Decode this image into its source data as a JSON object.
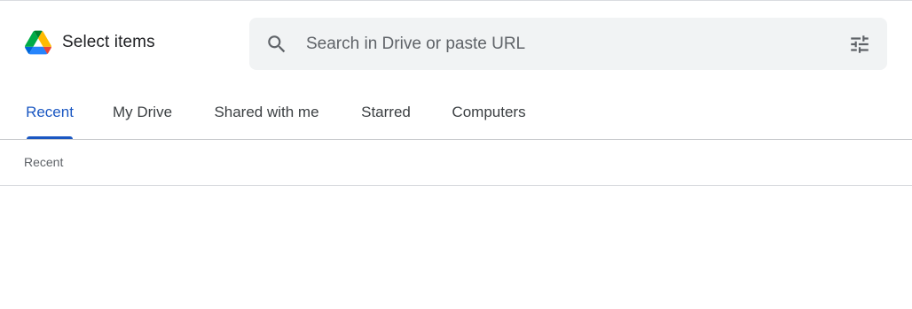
{
  "header": {
    "title": "Select items",
    "logo": "google-drive-logo"
  },
  "search": {
    "placeholder": "Search in Drive or paste URL",
    "value": "",
    "icon": "search-icon",
    "filter_icon": "tune-icon"
  },
  "tabs": [
    {
      "label": "Recent",
      "active": true
    },
    {
      "label": "My Drive",
      "active": false
    },
    {
      "label": "Shared with me",
      "active": false
    },
    {
      "label": "Starred",
      "active": false
    },
    {
      "label": "Computers",
      "active": false
    }
  ],
  "section": {
    "label": "Recent"
  },
  "colors": {
    "accent": "#1a57c2",
    "search_bg": "#f1f3f4",
    "text_primary": "#202124",
    "text_secondary": "#5f6368"
  }
}
